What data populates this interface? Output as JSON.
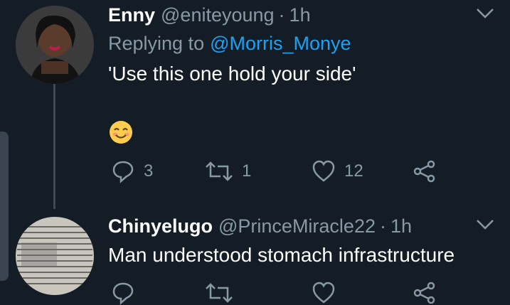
{
  "tweets": [
    {
      "name": "Enny",
      "handle": "@eniteyoung",
      "time": "1h",
      "replying_prefix": "Replying to",
      "replying_to": "@Morris_Monye",
      "text": "'Use this one hold your side'",
      "emoji": "smiling-face-emoji",
      "actions": {
        "replies": "3",
        "retweets": "1",
        "likes": "12"
      }
    },
    {
      "name": "Chinyelugo",
      "handle": "@PrinceMiracle22",
      "time": "1h",
      "text": "Man understood stomach infrastructure"
    }
  ],
  "colors": {
    "background": "#141d26",
    "muted": "#8899a6",
    "link": "#1da1f2"
  }
}
